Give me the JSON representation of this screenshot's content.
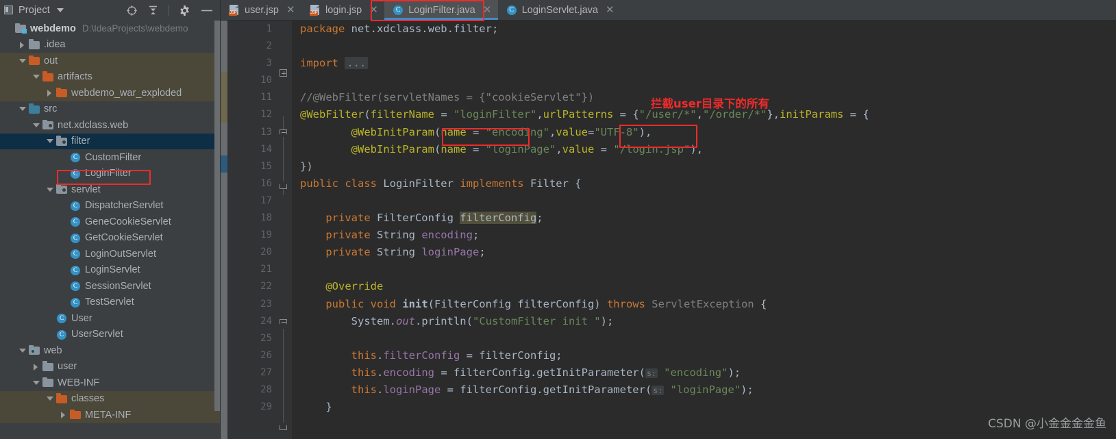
{
  "sidebar": {
    "header": {
      "title": "Project",
      "project_icon": "project-panel-icon",
      "dropdown_icon": "chevron-down-icon",
      "locate_icon": "locate-target-icon",
      "collapse_icon": "collapse-all-icon",
      "settings_icon": "gear-icon",
      "hide_icon": "minimize-icon"
    },
    "tree": [
      {
        "label": "webdemo",
        "path": "D:\\IdeaProjects\\webdemo",
        "indent": 0,
        "arrow": "none",
        "icon": "module-folder",
        "bold": true,
        "row": "normal"
      },
      {
        "label": ".idea",
        "path": "",
        "indent": 1,
        "arrow": "right",
        "icon": "folder-gray",
        "bold": false,
        "row": "normal"
      },
      {
        "label": "out",
        "path": "",
        "indent": 1,
        "arrow": "down",
        "icon": "folder-orange",
        "bold": false,
        "row": "alt"
      },
      {
        "label": "artifacts",
        "path": "",
        "indent": 2,
        "arrow": "down",
        "icon": "folder-orange",
        "bold": false,
        "row": "alt"
      },
      {
        "label": "webdemo_war_exploded",
        "path": "",
        "indent": 3,
        "arrow": "right",
        "icon": "folder-orange",
        "bold": false,
        "row": "alt"
      },
      {
        "label": "src",
        "path": "",
        "indent": 1,
        "arrow": "down",
        "icon": "folder-blue",
        "bold": false,
        "row": "normal"
      },
      {
        "label": "net.xdclass.web",
        "path": "",
        "indent": 2,
        "arrow": "down",
        "icon": "package",
        "bold": false,
        "row": "normal"
      },
      {
        "label": "filter",
        "path": "",
        "indent": 3,
        "arrow": "down",
        "icon": "package",
        "bold": false,
        "row": "sel"
      },
      {
        "label": "CustomFilter",
        "path": "",
        "indent": 4,
        "arrow": "none",
        "icon": "java-class",
        "bold": false,
        "row": "normal"
      },
      {
        "label": "LoginFilter",
        "path": "",
        "indent": 4,
        "arrow": "none",
        "icon": "java-class",
        "bold": false,
        "row": "normal"
      },
      {
        "label": "servlet",
        "path": "",
        "indent": 3,
        "arrow": "down",
        "icon": "package",
        "bold": false,
        "row": "normal"
      },
      {
        "label": "DispatcherServlet",
        "path": "",
        "indent": 4,
        "arrow": "none",
        "icon": "java-class",
        "bold": false,
        "row": "normal"
      },
      {
        "label": "GeneCookieServlet",
        "path": "",
        "indent": 4,
        "arrow": "none",
        "icon": "java-class",
        "bold": false,
        "row": "normal"
      },
      {
        "label": "GetCookieServlet",
        "path": "",
        "indent": 4,
        "arrow": "none",
        "icon": "java-class",
        "bold": false,
        "row": "normal"
      },
      {
        "label": "LoginOutServlet",
        "path": "",
        "indent": 4,
        "arrow": "none",
        "icon": "java-class",
        "bold": false,
        "row": "normal"
      },
      {
        "label": "LoginServlet",
        "path": "",
        "indent": 4,
        "arrow": "none",
        "icon": "java-class",
        "bold": false,
        "row": "normal"
      },
      {
        "label": "SessionServlet",
        "path": "",
        "indent": 4,
        "arrow": "none",
        "icon": "java-class",
        "bold": false,
        "row": "normal"
      },
      {
        "label": "TestServlet",
        "path": "",
        "indent": 4,
        "arrow": "none",
        "icon": "java-class",
        "bold": false,
        "row": "normal"
      },
      {
        "label": "User",
        "path": "",
        "indent": 3,
        "arrow": "none",
        "icon": "java-class",
        "bold": false,
        "row": "normal"
      },
      {
        "label": "UserServlet",
        "path": "",
        "indent": 3,
        "arrow": "none",
        "icon": "java-class",
        "bold": false,
        "row": "normal"
      },
      {
        "label": "web",
        "path": "",
        "indent": 1,
        "arrow": "down",
        "icon": "web-resource",
        "bold": false,
        "row": "normal"
      },
      {
        "label": "user",
        "path": "",
        "indent": 2,
        "arrow": "right",
        "icon": "folder-gray",
        "bold": false,
        "row": "normal"
      },
      {
        "label": "WEB-INF",
        "path": "",
        "indent": 2,
        "arrow": "down",
        "icon": "folder-gray",
        "bold": false,
        "row": "normal"
      },
      {
        "label": "classes",
        "path": "",
        "indent": 3,
        "arrow": "down",
        "icon": "folder-orange",
        "bold": false,
        "row": "alt"
      },
      {
        "label": "META-INF",
        "path": "",
        "indent": 4,
        "arrow": "right",
        "icon": "folder-orange",
        "bold": false,
        "row": "alt"
      }
    ],
    "highlight_item": "LoginFilter"
  },
  "tabs": [
    {
      "label": "user.jsp",
      "icon": "jsp-file-icon",
      "badge": "JSP",
      "active": false,
      "closable": true
    },
    {
      "label": "login.jsp",
      "icon": "jsp-file-icon",
      "badge": "JSP",
      "active": false,
      "closable": true
    },
    {
      "label": "LoginFilter.java",
      "icon": "java-class-icon",
      "badge": "C",
      "active": true,
      "closable": true
    },
    {
      "label": "LoginServlet.java",
      "icon": "java-class-icon",
      "badge": "C",
      "active": false,
      "closable": true
    }
  ],
  "editor": {
    "line_numbers": [
      1,
      2,
      3,
      10,
      11,
      12,
      13,
      14,
      15,
      16,
      17,
      18,
      19,
      20,
      21,
      22,
      23,
      24,
      25,
      26,
      27,
      28,
      29
    ],
    "lines": [
      {
        "n": 1,
        "text": "package net.xdclass.web.filter;"
      },
      {
        "n": 2,
        "text": ""
      },
      {
        "n": 3,
        "text": "import ..."
      },
      {
        "n": 10,
        "text": ""
      },
      {
        "n": 11,
        "text": "//@WebFilter(servletNames = {\"cookieServlet\"})"
      },
      {
        "n": 12,
        "text": "@WebFilter(filterName = \"loginFilter\",urlPatterns = {\"/user/*\",\"/order/*\"},initParams = {"
      },
      {
        "n": 13,
        "text": "        @WebInitParam(name = \"encoding\",value=\"UTF-8\"),"
      },
      {
        "n": 14,
        "text": "        @WebInitParam(name = \"loginPage\",value = \"/login.jsp\"),"
      },
      {
        "n": 15,
        "text": "})"
      },
      {
        "n": 16,
        "text": "public class LoginFilter implements Filter {"
      },
      {
        "n": 17,
        "text": ""
      },
      {
        "n": 18,
        "text": "    private FilterConfig filterConfig;"
      },
      {
        "n": 19,
        "text": "    private String encoding;"
      },
      {
        "n": 20,
        "text": "    private String loginPage;"
      },
      {
        "n": 21,
        "text": ""
      },
      {
        "n": 22,
        "text": "    @Override"
      },
      {
        "n": 23,
        "text": "    public void init(FilterConfig filterConfig) throws ServletException {"
      },
      {
        "n": 24,
        "text": "        System.out.println(\"CustomFilter init \");"
      },
      {
        "n": 25,
        "text": ""
      },
      {
        "n": 26,
        "text": "        this.filterConfig = filterConfig;"
      },
      {
        "n": 27,
        "text": "        this.encoding = filterConfig.getInitParameter( s: \"encoding\");"
      },
      {
        "n": 28,
        "text": "        this.loginPage = filterConfig.getInitParameter( s: \"loginPage\");"
      },
      {
        "n": 29,
        "text": "    }"
      }
    ],
    "param_hints": [
      "s:",
      "s:"
    ]
  },
  "annotations": {
    "note_text": "拦截user目录下的所有",
    "highlight_color": "#ef2b2b",
    "boxes": [
      "loginFilter-string",
      "user-url-pattern",
      "LoginFilter-tab",
      "LoginFilter-tree-item"
    ]
  },
  "watermark": "CSDN @小金金金金鱼"
}
